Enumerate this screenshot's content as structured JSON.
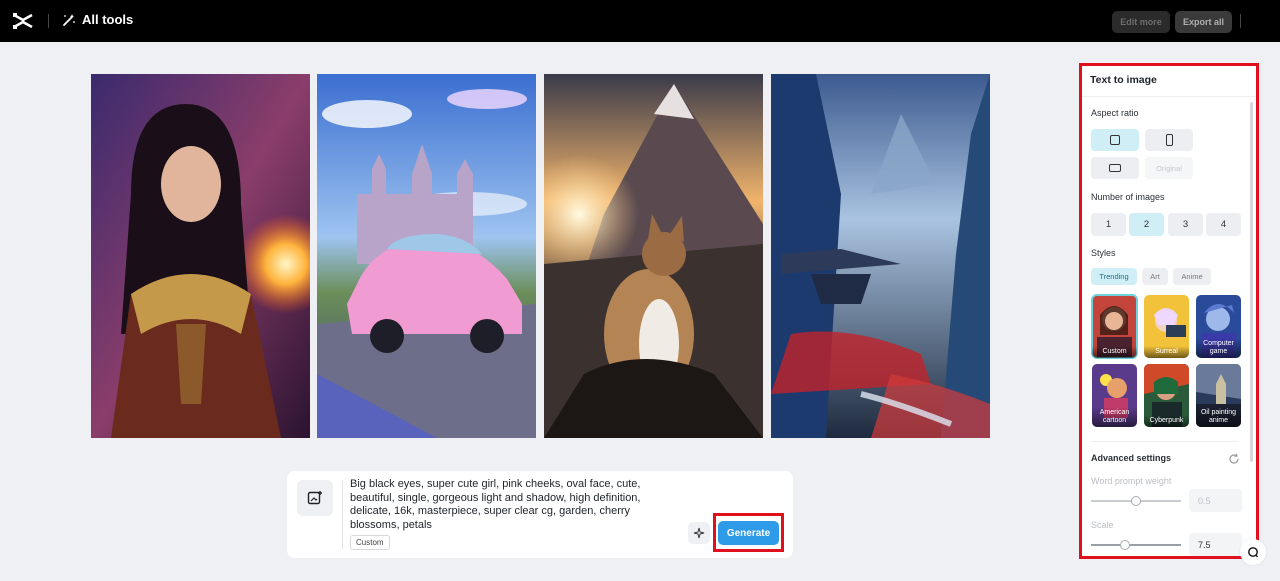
{
  "topbar": {
    "all_tools_label": "All tools",
    "edit_more_label": "Edit more",
    "export_all_label": "Export all"
  },
  "gallery": {
    "images": [
      {
        "subject": "fantasy-woman-with-fireball"
      },
      {
        "subject": "pink-car-and-castle"
      },
      {
        "subject": "cat-at-sunset-mountains"
      },
      {
        "subject": "misty-mountain-temple"
      }
    ]
  },
  "prompt": {
    "text": "Big black eyes, super cute girl, pink cheeks, oval face, cute, beautiful, single, gorgeous light and shadow, high definition, delicate, 16k, masterpiece, super clear cg, garden, cherry blossoms, petals",
    "style_tag": "Custom",
    "generate_label": "Generate"
  },
  "panel": {
    "title": "Text to image",
    "aspect_ratio": {
      "label": "Aspect ratio",
      "options": [
        {
          "name": "square",
          "selected": true
        },
        {
          "name": "portrait",
          "selected": false
        },
        {
          "name": "landscape",
          "selected": false
        },
        {
          "name": "original",
          "label": "Original",
          "selected": false,
          "disabled": true
        }
      ]
    },
    "number_of_images": {
      "label": "Number of images",
      "options": [
        "1",
        "2",
        "3",
        "4"
      ],
      "selected": "2"
    },
    "styles": {
      "label": "Styles",
      "tabs": [
        "Trending",
        "Art",
        "Anime"
      ],
      "selected_tab": "Trending",
      "items": [
        {
          "label": "Custom",
          "selected": true
        },
        {
          "label": "Surreal",
          "selected": false
        },
        {
          "label": "Computer game",
          "selected": false
        },
        {
          "label": "American cartoon",
          "selected": false
        },
        {
          "label": "Cyberpunk",
          "selected": false
        },
        {
          "label": "Oil painting anime",
          "selected": false
        }
      ]
    },
    "advanced": {
      "label": "Advanced settings",
      "word_prompt_weight": {
        "label": "Word prompt weight",
        "value": "0.5",
        "fraction": 0.5
      },
      "scale": {
        "label": "Scale",
        "value": "7.5",
        "fraction": 0.38
      }
    }
  },
  "colors": {
    "accent": "#2e9be8",
    "highlight_outline": "#e0101c",
    "selected_bg": "#cfeef5"
  }
}
